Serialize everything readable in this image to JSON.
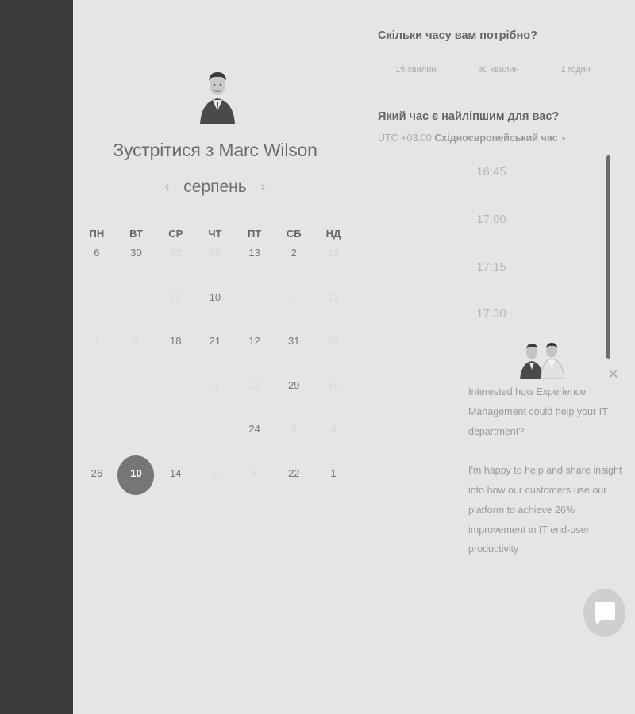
{
  "host": {
    "title_prefix": "Зустрітися з",
    "name": "Marc Wilson"
  },
  "calendar": {
    "month": "серпень",
    "prev_icon": "chevron-left-icon",
    "next_icon": "chevron-right-icon",
    "weekdays": [
      "ПН",
      "ВТ",
      "СР",
      "ЧТ",
      "ПТ",
      "СБ",
      "НД"
    ],
    "weeks": [
      [
        {
          "d": "6",
          "s": "on"
        },
        {
          "d": "30",
          "s": "on"
        },
        {
          "d": "22",
          "s": "faded"
        },
        {
          "d": "28",
          "s": "faded"
        },
        {
          "d": "13",
          "s": "on"
        },
        {
          "d": "2",
          "s": "on"
        },
        {
          "d": "12",
          "s": "faded"
        }
      ],
      [
        {
          "d": "",
          "s": "faded"
        },
        {
          "d": "",
          "s": "faded"
        },
        {
          "d": "11",
          "s": "faded"
        },
        {
          "d": "10",
          "s": "on"
        },
        {
          "d": "",
          "s": "faded"
        },
        {
          "d": "1",
          "s": "faded"
        },
        {
          "d": "11",
          "s": "faded"
        }
      ],
      [
        {
          "d": "7",
          "s": "faded"
        },
        {
          "d": "4",
          "s": "faded"
        },
        {
          "d": "18",
          "s": "on"
        },
        {
          "d": "21",
          "s": "on"
        },
        {
          "d": "12",
          "s": "on"
        },
        {
          "d": "31",
          "s": "on"
        },
        {
          "d": "24",
          "s": "faded"
        }
      ],
      [
        {
          "d": "",
          "s": "faded"
        },
        {
          "d": "",
          "s": "faded"
        },
        {
          "d": "",
          "s": "faded"
        },
        {
          "d": "4",
          "s": "faded"
        },
        {
          "d": "12",
          "s": "faded"
        },
        {
          "d": "29",
          "s": "on"
        },
        {
          "d": "14",
          "s": "faded"
        }
      ],
      [
        {
          "d": "",
          "s": "faded"
        },
        {
          "d": "",
          "s": "faded"
        },
        {
          "d": "",
          "s": "faded"
        },
        {
          "d": "",
          "s": "faded"
        },
        {
          "d": "24",
          "s": "on"
        },
        {
          "d": "3",
          "s": "faded"
        },
        {
          "d": "4",
          "s": "faded"
        }
      ],
      [
        {
          "d": "26",
          "s": "on"
        },
        {
          "d": "10",
          "s": "selected"
        },
        {
          "d": "14",
          "s": "on"
        },
        {
          "d": "5",
          "s": "faded"
        },
        {
          "d": "4",
          "s": "faded"
        },
        {
          "d": "22",
          "s": "on"
        },
        {
          "d": "1",
          "s": "on"
        }
      ]
    ]
  },
  "duration": {
    "question": "Скільки часу вам потрібно?",
    "options": [
      "15 хвилин",
      "30 хвилин",
      "1 годин"
    ]
  },
  "time": {
    "question": "Який час є найліпшим для вас?",
    "tz_offset": "UTC +03:00",
    "tz_name": "Східноєвропейський час",
    "slots": [
      "16:45",
      "17:00",
      "17:15",
      "17:30"
    ]
  },
  "chat": {
    "paragraph1": "Interested how Experience Management could help your IT department?",
    "paragraph2": "I'm happy to help and share insight into how our customers use our platform to achieve 26% improvement in IT end-user productivity",
    "close_icon": "close-icon",
    "button_icon": "chat-bubble-icon"
  }
}
